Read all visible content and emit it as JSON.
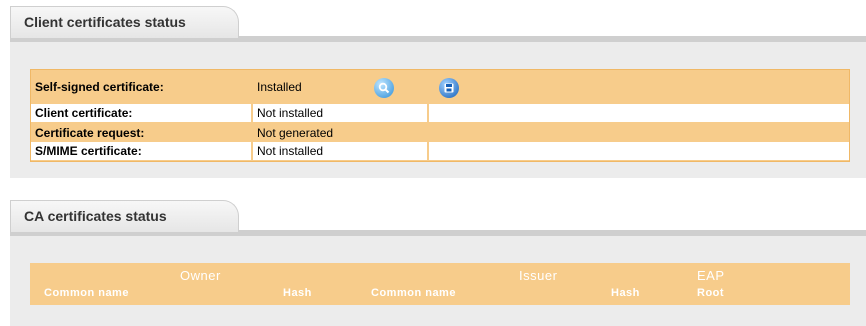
{
  "client_section": {
    "title": "Client certificates status",
    "rows": [
      {
        "label": "Self-signed certificate:",
        "status": "Installed"
      },
      {
        "label": "Client certificate:",
        "status": "Not installed"
      },
      {
        "label": "Certificate request:",
        "status": "Not generated"
      },
      {
        "label": "S/MIME certificate:",
        "status": "Not installed"
      }
    ],
    "icons": {
      "view": "search-icon",
      "save": "save-icon"
    },
    "colors": {
      "row_bg": "#f7cc8b",
      "panel_bg": "#ececec"
    }
  },
  "ca_section": {
    "title": "CA certificates status",
    "groups": {
      "owner": "Owner",
      "issuer": "Issuer",
      "eap": "EAP"
    },
    "columns": {
      "owner_common_name": "Common name",
      "owner_hash": "Hash",
      "issuer_common_name": "Common name",
      "issuer_hash": "Hash",
      "eap_root": "Root"
    }
  }
}
